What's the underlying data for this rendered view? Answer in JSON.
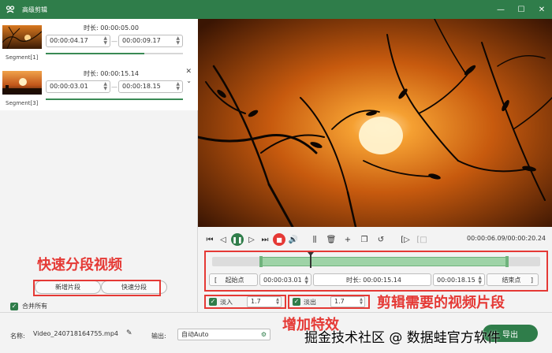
{
  "window": {
    "title": "高级剪辑",
    "controls": {
      "minimize": "—",
      "maximize": "☐",
      "close": "✕"
    }
  },
  "segments": [
    {
      "label": "Segment[1]",
      "duration_label": "时长:",
      "duration": "00:00:05.00",
      "start": "00:00:04.17",
      "end": "00:00:09.17",
      "progress": 0.72
    },
    {
      "label": "Segment[3]",
      "duration_label": "时长:",
      "duration": "00:00:15.14",
      "start": "00:00:03.01",
      "end": "00:00:18.15",
      "progress": 1.0,
      "close_icon": "✕"
    }
  ],
  "left_buttons": {
    "add_segment": "新增片段",
    "quick_split": "快速分段"
  },
  "merge_all": {
    "label": "合并所有",
    "checked": true
  },
  "player": {
    "time_current": "00:00:06.09",
    "time_total": "00:00:20.24",
    "time_separator": "/"
  },
  "trim": {
    "start_button": "起始点",
    "start_value": "00:00:03.01",
    "duration_label": "时长:",
    "duration_value": "00:00:15.14",
    "end_value": "00:00:18.15",
    "end_button": "结束点",
    "selection_start": 0.15,
    "selection_end": 0.9,
    "cursor": 0.3
  },
  "effects": {
    "fade_in": {
      "label": "淡入",
      "value": "1.7",
      "checked": true
    },
    "fade_out": {
      "label": "淡出",
      "value": "1.7",
      "checked": true
    }
  },
  "bottom": {
    "name_label": "名称:",
    "file_name": "Video_240718164755.mp4",
    "output_label": "输出:",
    "output_value": "自动Auto",
    "export_label": "导出"
  },
  "annotations": {
    "quick_split": "快速分段视频",
    "trim": "剪辑需要的视频片段",
    "effects": "增加特效"
  },
  "watermark": "掘金技术社区 @ 数据蛙官方软件",
  "colors": {
    "brand": "#2f7d4a",
    "annotation": "#e53935"
  }
}
